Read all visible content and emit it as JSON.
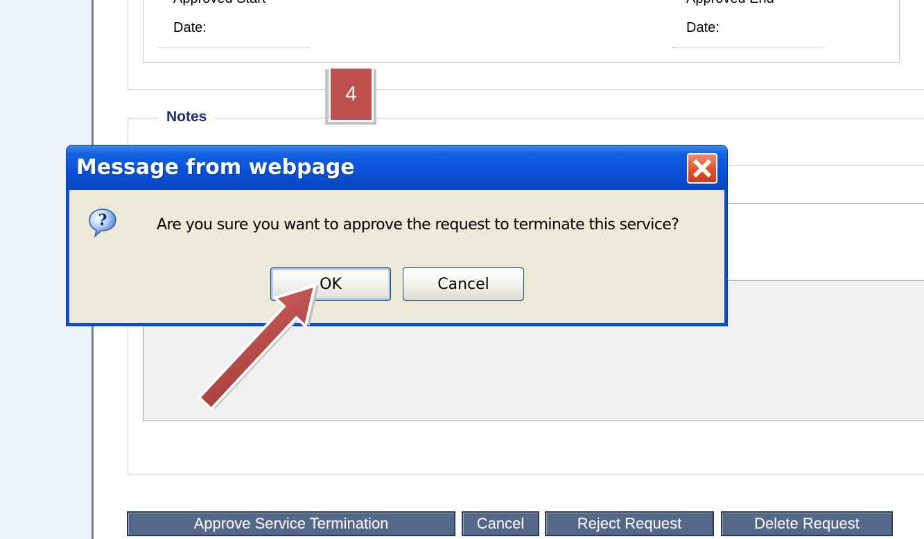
{
  "form": {
    "approved_start_label_top": "Approved Start",
    "approved_start_label_bottom": "Date:",
    "approved_end_label_top": "Approved End",
    "approved_end_label_bottom": "Date:",
    "notes_legend": "Notes"
  },
  "annotation": {
    "step_number": "4"
  },
  "dialog": {
    "title": "Message from webpage",
    "message": "Are you sure you want to approve the request to terminate this service?",
    "ok_label": "OK",
    "cancel_label": "Cancel",
    "icon": "question-icon"
  },
  "actions": {
    "approve_label": "Approve Service Termination",
    "cancel_label": "Cancel",
    "reject_label": "Reject Request",
    "delete_label": "Delete Request"
  },
  "colors": {
    "dialog_title_bar": "#0a50d6",
    "dialog_body": "#ece9d8",
    "close_button": "#e2502b",
    "action_button": "#56688a",
    "legend_text": "#1a2d74",
    "step_badge": "#c0504d",
    "arrow": "#c0504d"
  }
}
